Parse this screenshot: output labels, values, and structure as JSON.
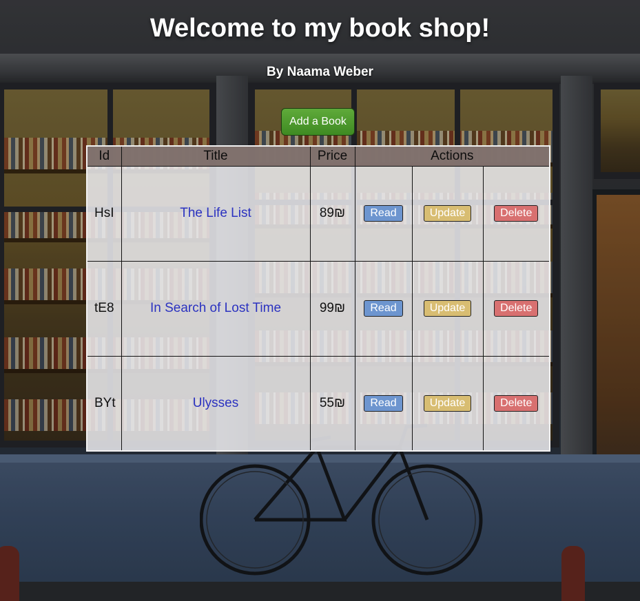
{
  "header": {
    "title": "Welcome to my book shop!",
    "subtitle": "By Naama Weber"
  },
  "toolbar": {
    "add_label": "Add a Book"
  },
  "table": {
    "columns": [
      "Id",
      "Title",
      "Price",
      "Actions"
    ],
    "rows": [
      {
        "id": "HsI",
        "title": "The Life List",
        "price": "89₪",
        "read": "Read",
        "update": "Update",
        "delete": "Delete"
      },
      {
        "id": "tE8",
        "title": "In Search of Lost Time",
        "price": "99₪",
        "read": "Read",
        "update": "Update",
        "delete": "Delete"
      },
      {
        "id": "BYt",
        "title": "Ulysses",
        "price": "55₪",
        "read": "Read",
        "update": "Update",
        "delete": "Delete"
      }
    ]
  },
  "colors": {
    "add_button": "#4a9a2c",
    "read_button": "#6d95cf",
    "update_button": "#d8bd72",
    "delete_button": "#d87070",
    "title_link": "#2b32c0",
    "header_row": "#786864"
  },
  "background": "bookshop storefront photo with bicycle"
}
